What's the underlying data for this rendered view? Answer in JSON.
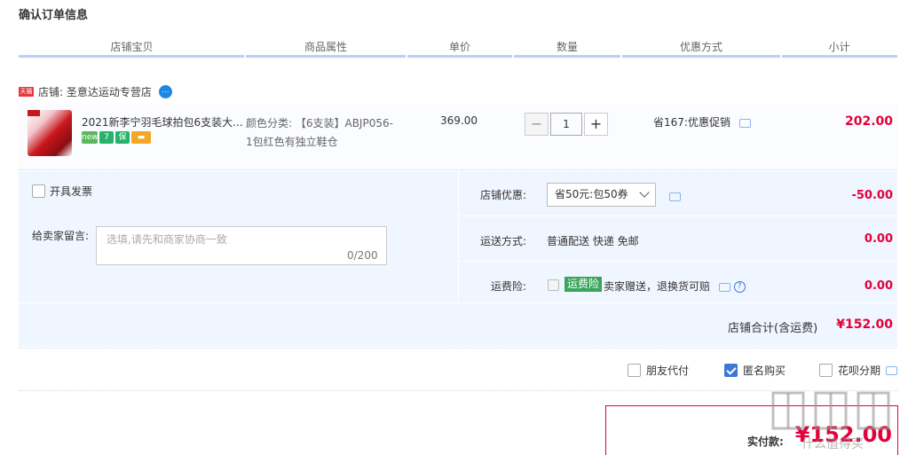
{
  "page_title": "确认订单信息",
  "table_headers": [
    "店铺宝贝",
    "商品属性",
    "单价",
    "数量",
    "优惠方式",
    "小计"
  ],
  "shop": {
    "tmall_tag": "天猫",
    "label": "店铺: 圣意达运动专营店",
    "wang_icon": "aliwangwang-icon"
  },
  "item": {
    "name": "2021新李宁羽毛球拍包6支装大...",
    "icons": [
      "new-icon",
      "7-day-return-icon",
      "guarantee-icon",
      "credit-card-icon"
    ],
    "attr_line1": "颜色分类: 【6支装】ABJP056-",
    "attr_line2": "1包红色有独立鞋仓",
    "price": "369.00",
    "quantity": "1",
    "promo": "省167:优惠促销",
    "subtotal": "202.00"
  },
  "invoice_label": "开具发票",
  "message": {
    "label": "给卖家留言:",
    "placeholder": "选填,请先和商家协商一致",
    "counter": "0/200"
  },
  "shop_discount": {
    "label": "店铺优惠:",
    "selected": "省50元:包50券",
    "amount": "-50.00"
  },
  "shipping": {
    "label": "运送方式:",
    "value": "普通配送 快递 免邮",
    "amount": "0.00"
  },
  "insurance": {
    "label": "运费险:",
    "tag": "运费险",
    "text": "卖家赠送，退换货可赔",
    "help": "?",
    "amount": "0.00"
  },
  "shop_total": {
    "label": "店铺合计(含运费)",
    "value": "¥152.00"
  },
  "order_options": {
    "friend_pay": "朋友代付",
    "anonymous": "匿名购买",
    "huabei": "花呗分期"
  },
  "pay": {
    "label": "实付款:",
    "value": "¥152.00"
  },
  "watermark": "值 什么值得买",
  "colors": {
    "accent_red": "#e4003a",
    "header_line": "#b2d1ff",
    "panel_bg": "#f0f6ff",
    "checked_blue": "#3c78d8",
    "insurance_green": "#3aa55c"
  }
}
